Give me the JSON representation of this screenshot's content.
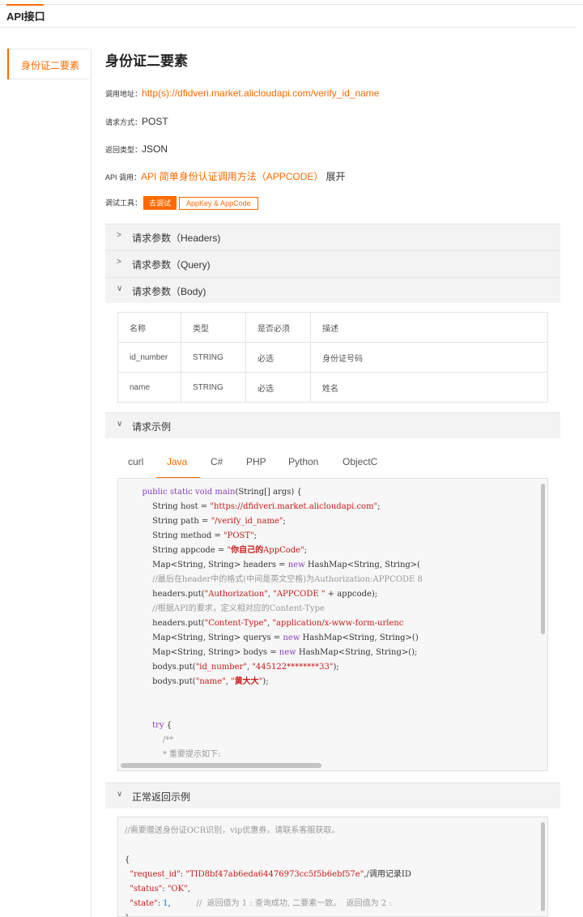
{
  "header": {
    "tab": "API接口"
  },
  "sidebar": {
    "items": [
      {
        "label": "身份证二要素"
      }
    ]
  },
  "main": {
    "title": "身份证二要素",
    "info": {
      "url_label": "调用地址：",
      "url": "http(s)://dfidveri.market.alicloudapi.com/verify_id_name",
      "method_label": "请求方式：",
      "method": "POST",
      "return_label": "返回类型：",
      "return_type": "JSON",
      "api_label": "API 调用：",
      "api_link": "API 简单身份认证调用方法（APPCODE）",
      "api_expand": "展开",
      "tools_label": "调试工具：",
      "try_btn": "去调试",
      "key_btn": "AppKey & AppCode"
    },
    "panels": [
      {
        "label": "请求参数（Headers)",
        "chevron": ">"
      },
      {
        "label": "请求参数（Query)",
        "chevron": ">"
      },
      {
        "label": "请求参数（Body)",
        "chevron": "∨"
      },
      {
        "label": "请求示例",
        "chevron": "∨"
      },
      {
        "label": "正常返回示例",
        "chevron": "∨"
      }
    ],
    "body_table": {
      "headers": [
        "名称",
        "类型",
        "是否必须",
        "描述"
      ],
      "rows": [
        [
          "id_number",
          "STRING",
          "必选",
          "身份证号码"
        ],
        [
          "name",
          "STRING",
          "必选",
          "姓名"
        ]
      ]
    },
    "code_tabs": [
      "curl",
      "Java",
      "C#",
      "PHP",
      "Python",
      "ObjectC"
    ],
    "active_tab": "Java"
  },
  "colors": {
    "accent": "#ff6a00"
  }
}
